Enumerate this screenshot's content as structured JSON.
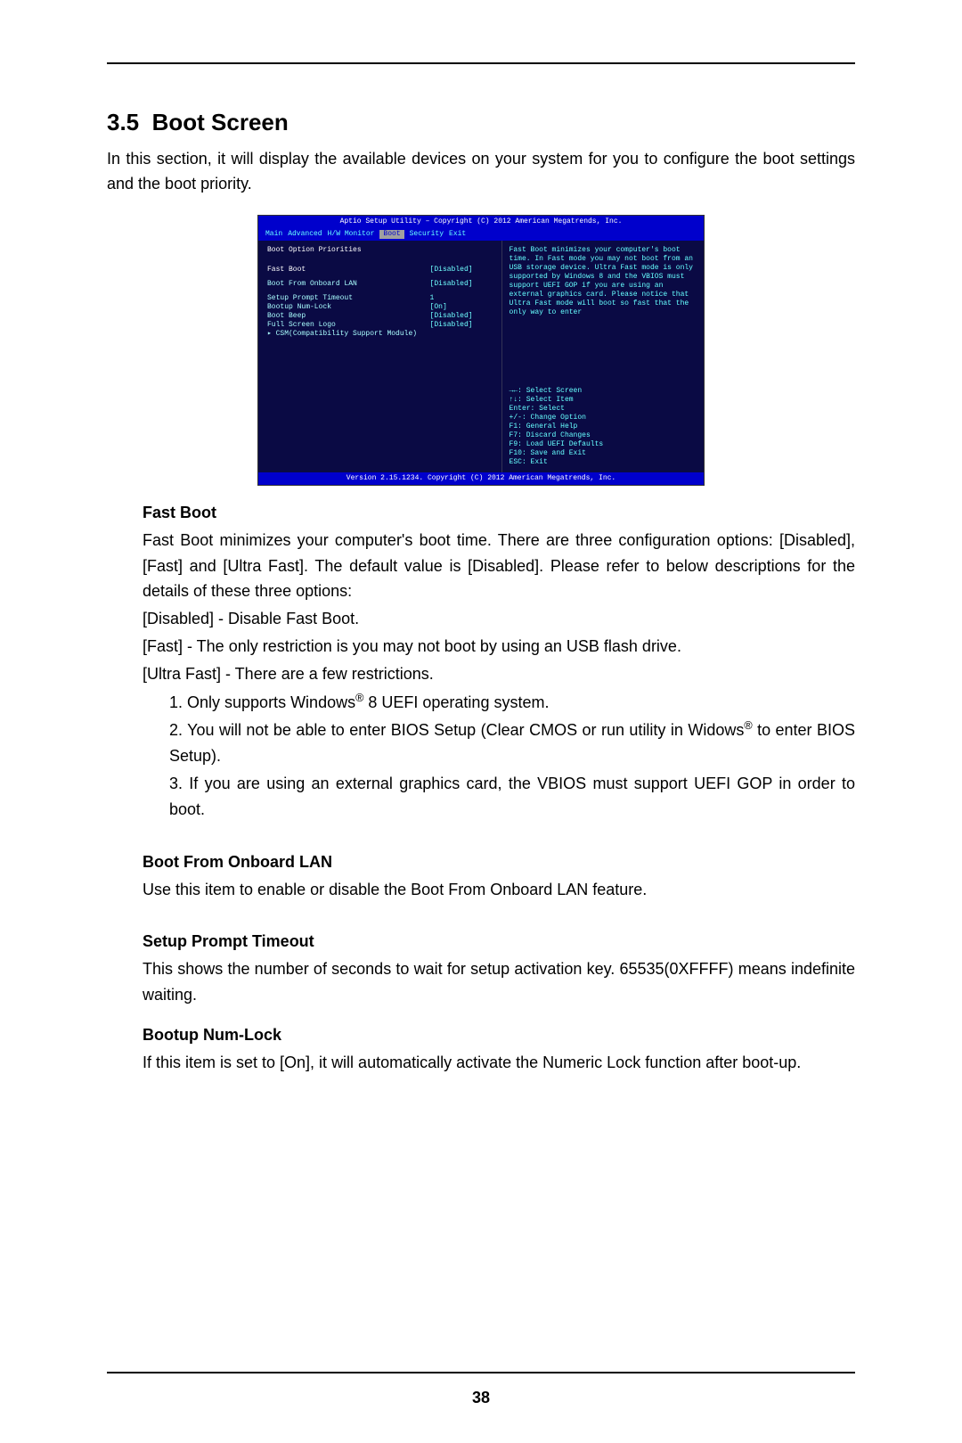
{
  "page_number": "38",
  "section": {
    "number": "3.5",
    "title": "Boot Screen"
  },
  "intro": "In this section, it will display the available devices on your system for you to configure the boot settings and the boot priority.",
  "bios": {
    "title": "Aptio Setup Utility – Copyright (C) 2012 American Megatrends, Inc.",
    "menu": [
      "Main",
      "Advanced",
      "H/W Monitor",
      "Boot",
      "Security",
      "Exit"
    ],
    "menu_active": "Boot",
    "left_header": "Boot Option Priorities",
    "items": [
      {
        "label": "Fast Boot",
        "value": "[Disabled]"
      },
      {
        "label": "Boot From Onboard LAN",
        "value": "[Disabled]"
      },
      {
        "label": "Setup Prompt Timeout",
        "value": "1"
      },
      {
        "label": "Bootup Num-Lock",
        "value": "[On]"
      },
      {
        "label": "Boot Beep",
        "value": "[Disabled]"
      },
      {
        "label": "Full Screen Logo",
        "value": "[Disabled]"
      },
      {
        "label": "▸ CSM(Compatibility Support Module)",
        "value": ""
      }
    ],
    "help": "Fast Boot minimizes your computer's boot time. In Fast mode you may not boot from an USB storage device. Ultra Fast mode is only supported by Windows 8 and the VBIOS must support UEFI GOP if you are using an external graphics card. Please notice that Ultra Fast mode will boot so fast that the only way to enter",
    "nav": [
      "→←: Select Screen",
      "↑↓: Select Item",
      "Enter: Select",
      "+/-: Change Option",
      "F1: General Help",
      "F7: Discard Changes",
      "F9: Load UEFI Defaults",
      "F10: Save and Exit",
      "ESC: Exit"
    ],
    "footer": "Version 2.15.1234. Copyright (C) 2012 American Megatrends, Inc."
  },
  "entries": {
    "fastboot": {
      "title": "Fast Boot",
      "p1": "Fast Boot minimizes your computer's boot time. There are three configuration options: [Disabled], [Fast] and [Ultra Fast]. The default value is [Disabled]. Please refer to below descriptions for the details of these three options:",
      "p2": "[Disabled] - Disable Fast Boot.",
      "p3": "[Fast] - The only restriction is you may not boot by using an USB flash drive.",
      "p4": "[Ultra Fast] - There are a few restrictions.",
      "li1a": "1. Only supports Windows",
      "li1b": " 8 UEFI operating system.",
      "li2a": "2. You will not be able to enter BIOS Setup (Clear CMOS or run utility in Widows",
      "li2b": " to enter BIOS Setup).",
      "li3": "3. If you are using an external graphics card, the VBIOS must support UEFI GOP in order to boot.",
      "reg": "®"
    },
    "onboardlan": {
      "title": "Boot From Onboard LAN",
      "body": "Use this item to enable or disable the Boot From Onboard LAN feature."
    },
    "prompttimeout": {
      "title": "Setup Prompt Timeout",
      "body": "This shows the number of seconds to wait for setup activation key. 65535(0XFFFF) means indefinite waiting."
    },
    "numlock": {
      "title": "Bootup Num-Lock",
      "body": "If this item is set to [On], it will automatically activate the Numeric Lock function after boot-up."
    }
  }
}
